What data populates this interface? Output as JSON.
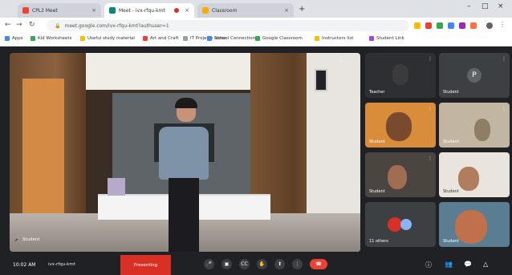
{
  "browser": {
    "tabs": [
      {
        "title": "CPL2 Meet"
      },
      {
        "title": "Meet - ivx-rfqu-kmt"
      },
      {
        "title": "Classroom"
      }
    ],
    "new_tab": "+",
    "url": "meet.google.com/ivx-rfqu-kmt?authuser=1",
    "bookmarks": [
      "Apps",
      "Kid Worksheets",
      "Useful study material",
      "Art and Craft",
      "IT Projects Ideas",
      "School Connection",
      "Google Classroom",
      "Instructors list",
      "Student Link"
    ]
  },
  "meeting": {
    "time": "10:02 AM",
    "code": "ivx-rfqu-kmt",
    "present_label": "Presenting",
    "main_speaker": "Student",
    "participants": [
      {
        "name": "Teacher",
        "initial": ""
      },
      {
        "name": "Student",
        "initial": "P"
      },
      {
        "name": "Student",
        "initial": ""
      },
      {
        "name": "Student",
        "initial": ""
      },
      {
        "name": "Student",
        "initial": ""
      },
      {
        "name": "Student",
        "initial": ""
      },
      {
        "name": "11 others",
        "initial": ""
      },
      {
        "name": "Student",
        "initial": ""
      }
    ]
  },
  "icons": {
    "mic": "mic-icon",
    "camera": "camera-icon",
    "captions": "captions-icon",
    "raise_hand": "hand-icon",
    "present": "present-icon",
    "more": "more-icon",
    "end": "end-call-icon",
    "info": "info-icon",
    "people": "people-icon",
    "chat": "chat-icon",
    "activities": "activities-icon"
  },
  "colors": {
    "end_call": "#ea4335",
    "present_banner": "#d93025",
    "meet_bg": "#202124"
  }
}
